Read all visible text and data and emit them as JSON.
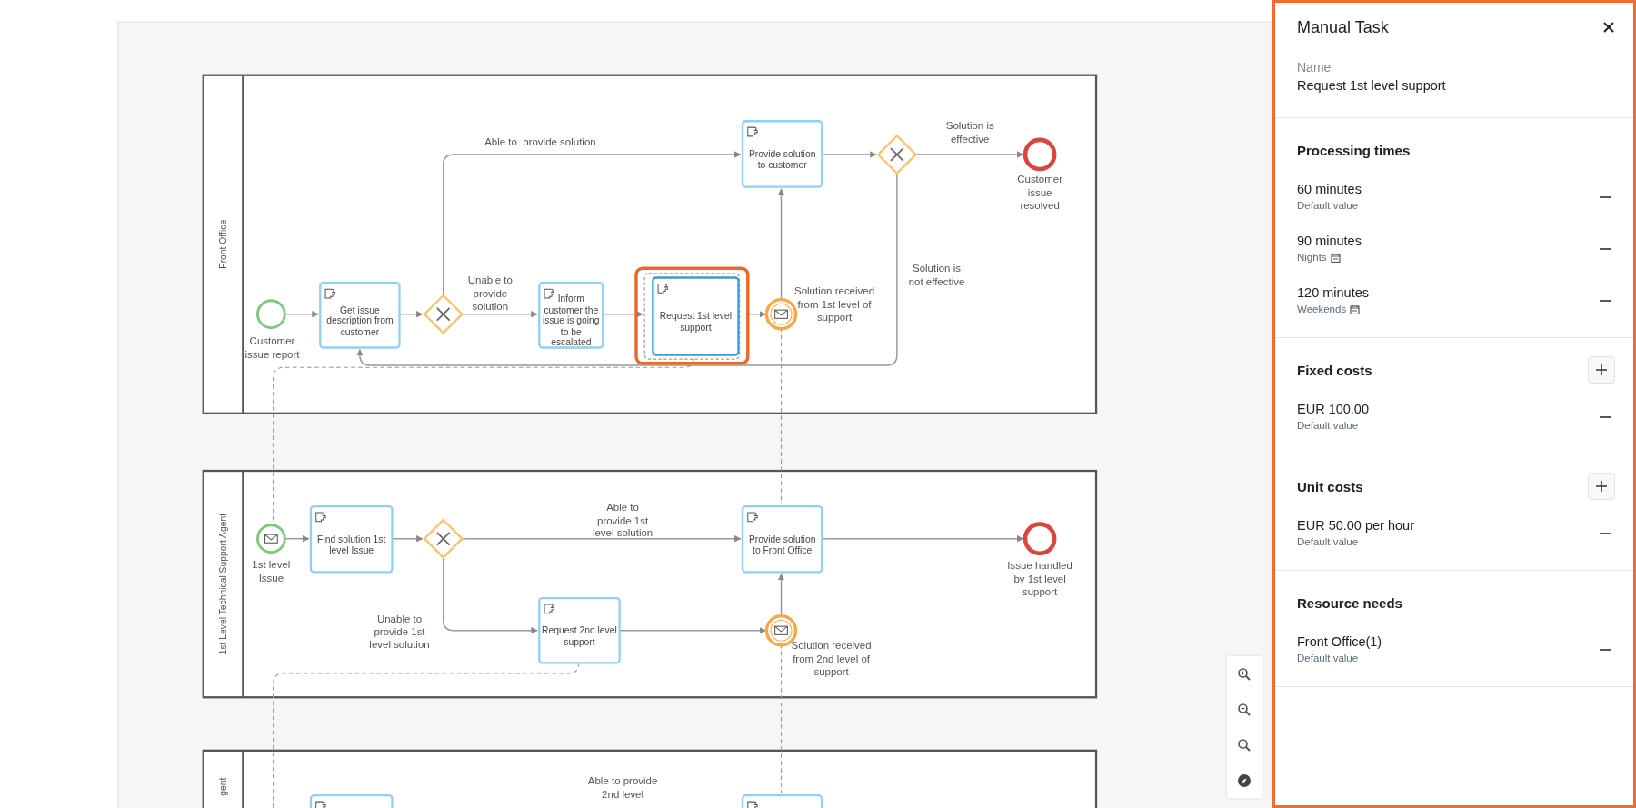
{
  "diagram": {
    "pools": [
      {
        "label": "Front Office"
      },
      {
        "label": "1st Level Technical Support Agent"
      },
      {
        "label": "gent"
      }
    ],
    "nodes": [
      {
        "kind": "start",
        "label": "Customer issue report",
        "selected": false
      },
      {
        "kind": "task",
        "label": "Get issue description from customer",
        "selected": false
      },
      {
        "kind": "gateway",
        "selected": false
      },
      {
        "kind": "task",
        "label": "Inform customer the issue is going to be escalated",
        "selected": false
      },
      {
        "kind": "task",
        "label": "Request 1st level support",
        "selected": true
      },
      {
        "kind": "intermediate-message",
        "label": "Solution received from 1st level of support",
        "selected": false
      },
      {
        "kind": "task",
        "label": "Provide solution to customer",
        "selected": false
      },
      {
        "kind": "gateway",
        "selected": false
      },
      {
        "kind": "end",
        "label": "Customer issue resolved",
        "selected": false
      },
      {
        "kind": "start-message",
        "label": "1st level Issue",
        "selected": false
      },
      {
        "kind": "task",
        "label": "Find solution 1st level Issue",
        "selected": false
      },
      {
        "kind": "gateway",
        "selected": false
      },
      {
        "kind": "task",
        "label": "Provide solution to Front Office",
        "selected": false
      },
      {
        "kind": "end",
        "label": "Issue handled by 1st level support",
        "selected": false
      },
      {
        "kind": "task",
        "label": "Request 2nd level support",
        "selected": false
      },
      {
        "kind": "intermediate-message",
        "label": "Solution received from 2nd level of support",
        "selected": false
      },
      {
        "kind": "task",
        "selected": false
      },
      {
        "kind": "task",
        "selected": false
      }
    ],
    "flow_labels": [
      "Able to  provide solution",
      "Unable to provide solution",
      "Solution is effective",
      "Solution is not effective",
      "Able to provide 1st level solution",
      "Unable to provide 1st level solution",
      "Able to provide 2nd level"
    ]
  },
  "panel": {
    "title": "Manual Task",
    "name_label": "Name",
    "name_value": "Request 1st level support",
    "sections": [
      {
        "title": "Processing times",
        "can_add": false,
        "entries": [
          {
            "value": "60 minutes",
            "note": "Default value",
            "calendar": false
          },
          {
            "value": "90 minutes",
            "note": "Nights",
            "calendar": true
          },
          {
            "value": "120 minutes",
            "note": "Weekends",
            "calendar": true
          }
        ]
      },
      {
        "title": "Fixed costs",
        "can_add": true,
        "entries": [
          {
            "value": "EUR 100.00",
            "note": "Default value",
            "calendar": false
          }
        ]
      },
      {
        "title": "Unit costs",
        "can_add": true,
        "entries": [
          {
            "value": "EUR 50.00 per hour",
            "note": "Default value",
            "calendar": false
          }
        ]
      },
      {
        "title": "Resource needs",
        "can_add": false,
        "entries": [
          {
            "value": "Front Office(1)",
            "note": "Default value",
            "calendar": false
          }
        ]
      }
    ]
  }
}
